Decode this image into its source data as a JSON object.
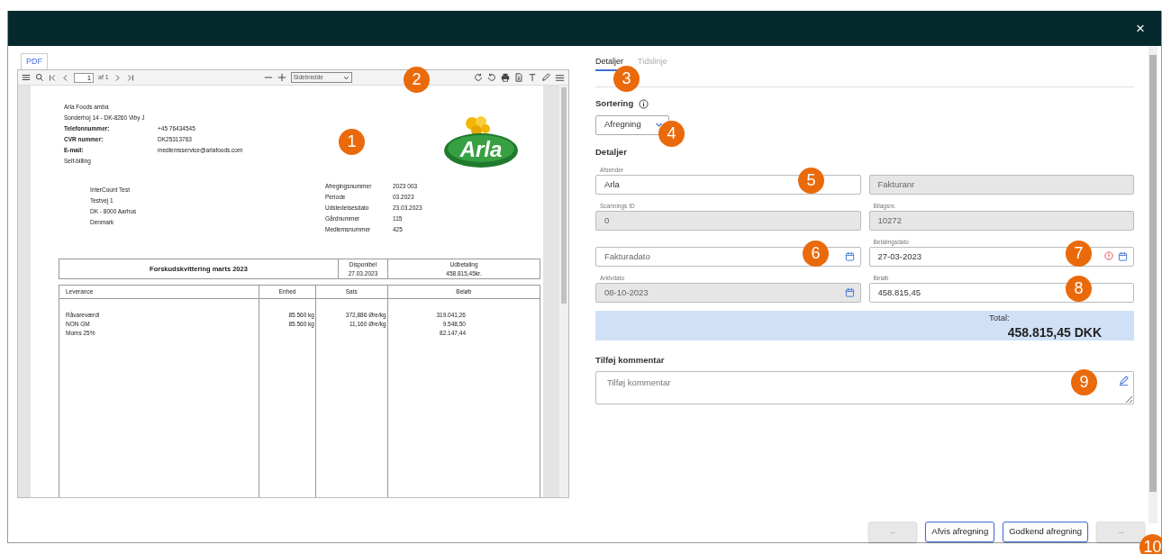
{
  "modal": {
    "close": "×"
  },
  "pdf_viewer": {
    "tab": "PDF",
    "page_input": "1",
    "page_count": "af 1",
    "zoom": "Sidebredde"
  },
  "document": {
    "sender": [
      {
        "label": "Arla Foods amba",
        "bold": false
      },
      {
        "label": "Sonderhoj 14 - DK-8260 Viby J",
        "bold": false
      },
      {
        "label": "Telefonnummer:",
        "value": "+45 76434545",
        "bold": true
      },
      {
        "label": "CVR nummer:",
        "value": "DK25313763",
        "bold": true
      },
      {
        "label": "E-mail:",
        "value": "medlemsservice@arlafoods.com",
        "bold": true
      },
      {
        "label": "Self-billing",
        "bold": false
      }
    ],
    "logo": "Arla",
    "recipient": [
      "InterCount Test",
      "Testvej 1",
      "DK - 8000 Aarhus",
      "Denmark"
    ],
    "meta": [
      {
        "label": "Afregingsnummer",
        "value": "2023  003"
      },
      {
        "label": "Periode",
        "value": "03.2023"
      },
      {
        "label": "Udstedelsesdato",
        "value": "23.03.2023"
      },
      {
        "label": "Gårdnummer",
        "value": "115"
      },
      {
        "label": "Medlemsnummer",
        "value": "425"
      }
    ],
    "summary": {
      "title": "Forskudskvittering marts 2023",
      "columns": [
        {
          "label": "Disponibel",
          "value": "27.03.2023"
        },
        {
          "label": "Udbetaling",
          "value": "458.815,45kr."
        }
      ]
    },
    "lines_table": {
      "columns": [
        "Leverance",
        "Enhed",
        "Sats",
        "Beløb"
      ],
      "rows": [
        [
          "Råvareværdi",
          "85.560 kg",
          "372,886 Øre/kg",
          "319.041,26"
        ],
        [
          "NON GM",
          "85.560 kg",
          "11,160 Øre/kg",
          "9.548,50"
        ],
        [
          "Moms 25%",
          null,
          null,
          "82.147,44"
        ]
      ]
    }
  },
  "tabs": [
    {
      "label": "Detaljer",
      "selected": true
    },
    {
      "label": "Tidslinje",
      "selected": false
    }
  ],
  "sorting": {
    "label": "Sortering",
    "value": "Afregning"
  },
  "details_heading": "Detaljer",
  "fields": [
    {
      "kind": "text",
      "label": "Afsender",
      "value": "Arla",
      "disabled": false,
      "warning": false
    },
    {
      "kind": "text",
      "placeholder": "Fakturanr",
      "disabled": true,
      "warning": false
    },
    {
      "kind": "text",
      "label": "Scannings ID",
      "value": "0",
      "disabled": true,
      "warning": false
    },
    {
      "kind": "text",
      "label": "Bilagsnr.",
      "value": "10272",
      "disabled": true,
      "warning": false
    },
    {
      "kind": "date",
      "placeholder": "Fakturadato",
      "disabled": false,
      "warning": false
    },
    {
      "kind": "date",
      "label": "Betalingsdato",
      "value": "27-03-2023",
      "disabled": false,
      "warning": true
    },
    {
      "kind": "date",
      "label": "Arkivdato",
      "value": "08-10-2023",
      "disabled": true,
      "warning": false
    },
    {
      "kind": "text",
      "label": "Beløb",
      "value": "458.815,45",
      "disabled": false,
      "warning": false
    }
  ],
  "total": {
    "label": "Total:",
    "amount": "458.815,45 DKK"
  },
  "comment": {
    "label": "Tilføj kommentar",
    "placeholder": "Tilføj kommentar"
  },
  "footer_buttons": [
    {
      "label": "←",
      "disabled": true
    },
    {
      "label": "Afvis afregning",
      "disabled": false
    },
    {
      "label": "Godkend afregning",
      "disabled": false
    },
    {
      "label": "→",
      "disabled": true
    }
  ],
  "callouts": [
    "1",
    "2",
    "3",
    "4",
    "5",
    "6",
    "7",
    "8",
    "9",
    "10"
  ]
}
